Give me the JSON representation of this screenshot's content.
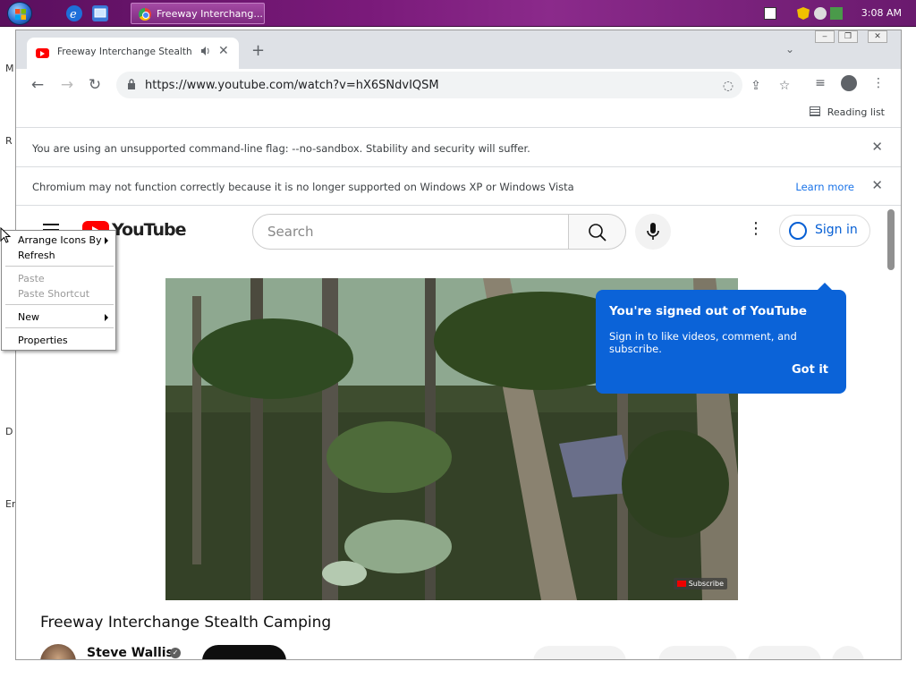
{
  "taskbar": {
    "task_title": "Freeway Interchang...",
    "clock": "3:08 AM"
  },
  "desktop": {
    "side_letters": [
      "M",
      "R",
      "D",
      "Er"
    ]
  },
  "browser": {
    "tab": {
      "title": "Freeway Interchange Stealth Ca",
      "speaker_icon": "speaker-icon",
      "close_glyph": "✕"
    },
    "newtab_glyph": "+",
    "tabsearch_glyph": "⌄",
    "url": "https://www.youtube.com/watch?v=hX6SNdvIQSM",
    "reading_list": "Reading list",
    "infobars": [
      {
        "message": "You are using an unsupported command-line flag: --no-sandbox. Stability and security will suffer."
      },
      {
        "message": "Chromium may not function correctly because it is no longer supported on Windows XP or Windows Vista",
        "link": "Learn more"
      }
    ]
  },
  "youtube": {
    "logo_text": "YouTube",
    "search_placeholder": "Search",
    "sign_in": "Sign in",
    "video_title": "Freeway Interchange Stealth Camping",
    "channel": "Steve Wallis",
    "subscribe_watermark": "Subscribe",
    "popup": {
      "heading": "You're signed out of YouTube",
      "body": "Sign in to like videos, comment, and subscribe.",
      "button": "Got it"
    }
  },
  "context_menu": {
    "items": [
      {
        "label": "Arrange Icons By",
        "submenu": true,
        "disabled": false
      },
      {
        "label": "Refresh",
        "submenu": false,
        "disabled": false
      },
      {
        "label": "Paste",
        "submenu": false,
        "disabled": true
      },
      {
        "label": "Paste Shortcut",
        "submenu": false,
        "disabled": true
      },
      {
        "label": "New",
        "submenu": true,
        "disabled": false
      },
      {
        "label": "Properties",
        "submenu": false,
        "disabled": false
      }
    ]
  },
  "colors": {
    "taskbar": "#7a1a7a",
    "youtube_red": "#ff0000",
    "popup_blue": "#0b63d8",
    "link_blue": "#1a73e8"
  }
}
